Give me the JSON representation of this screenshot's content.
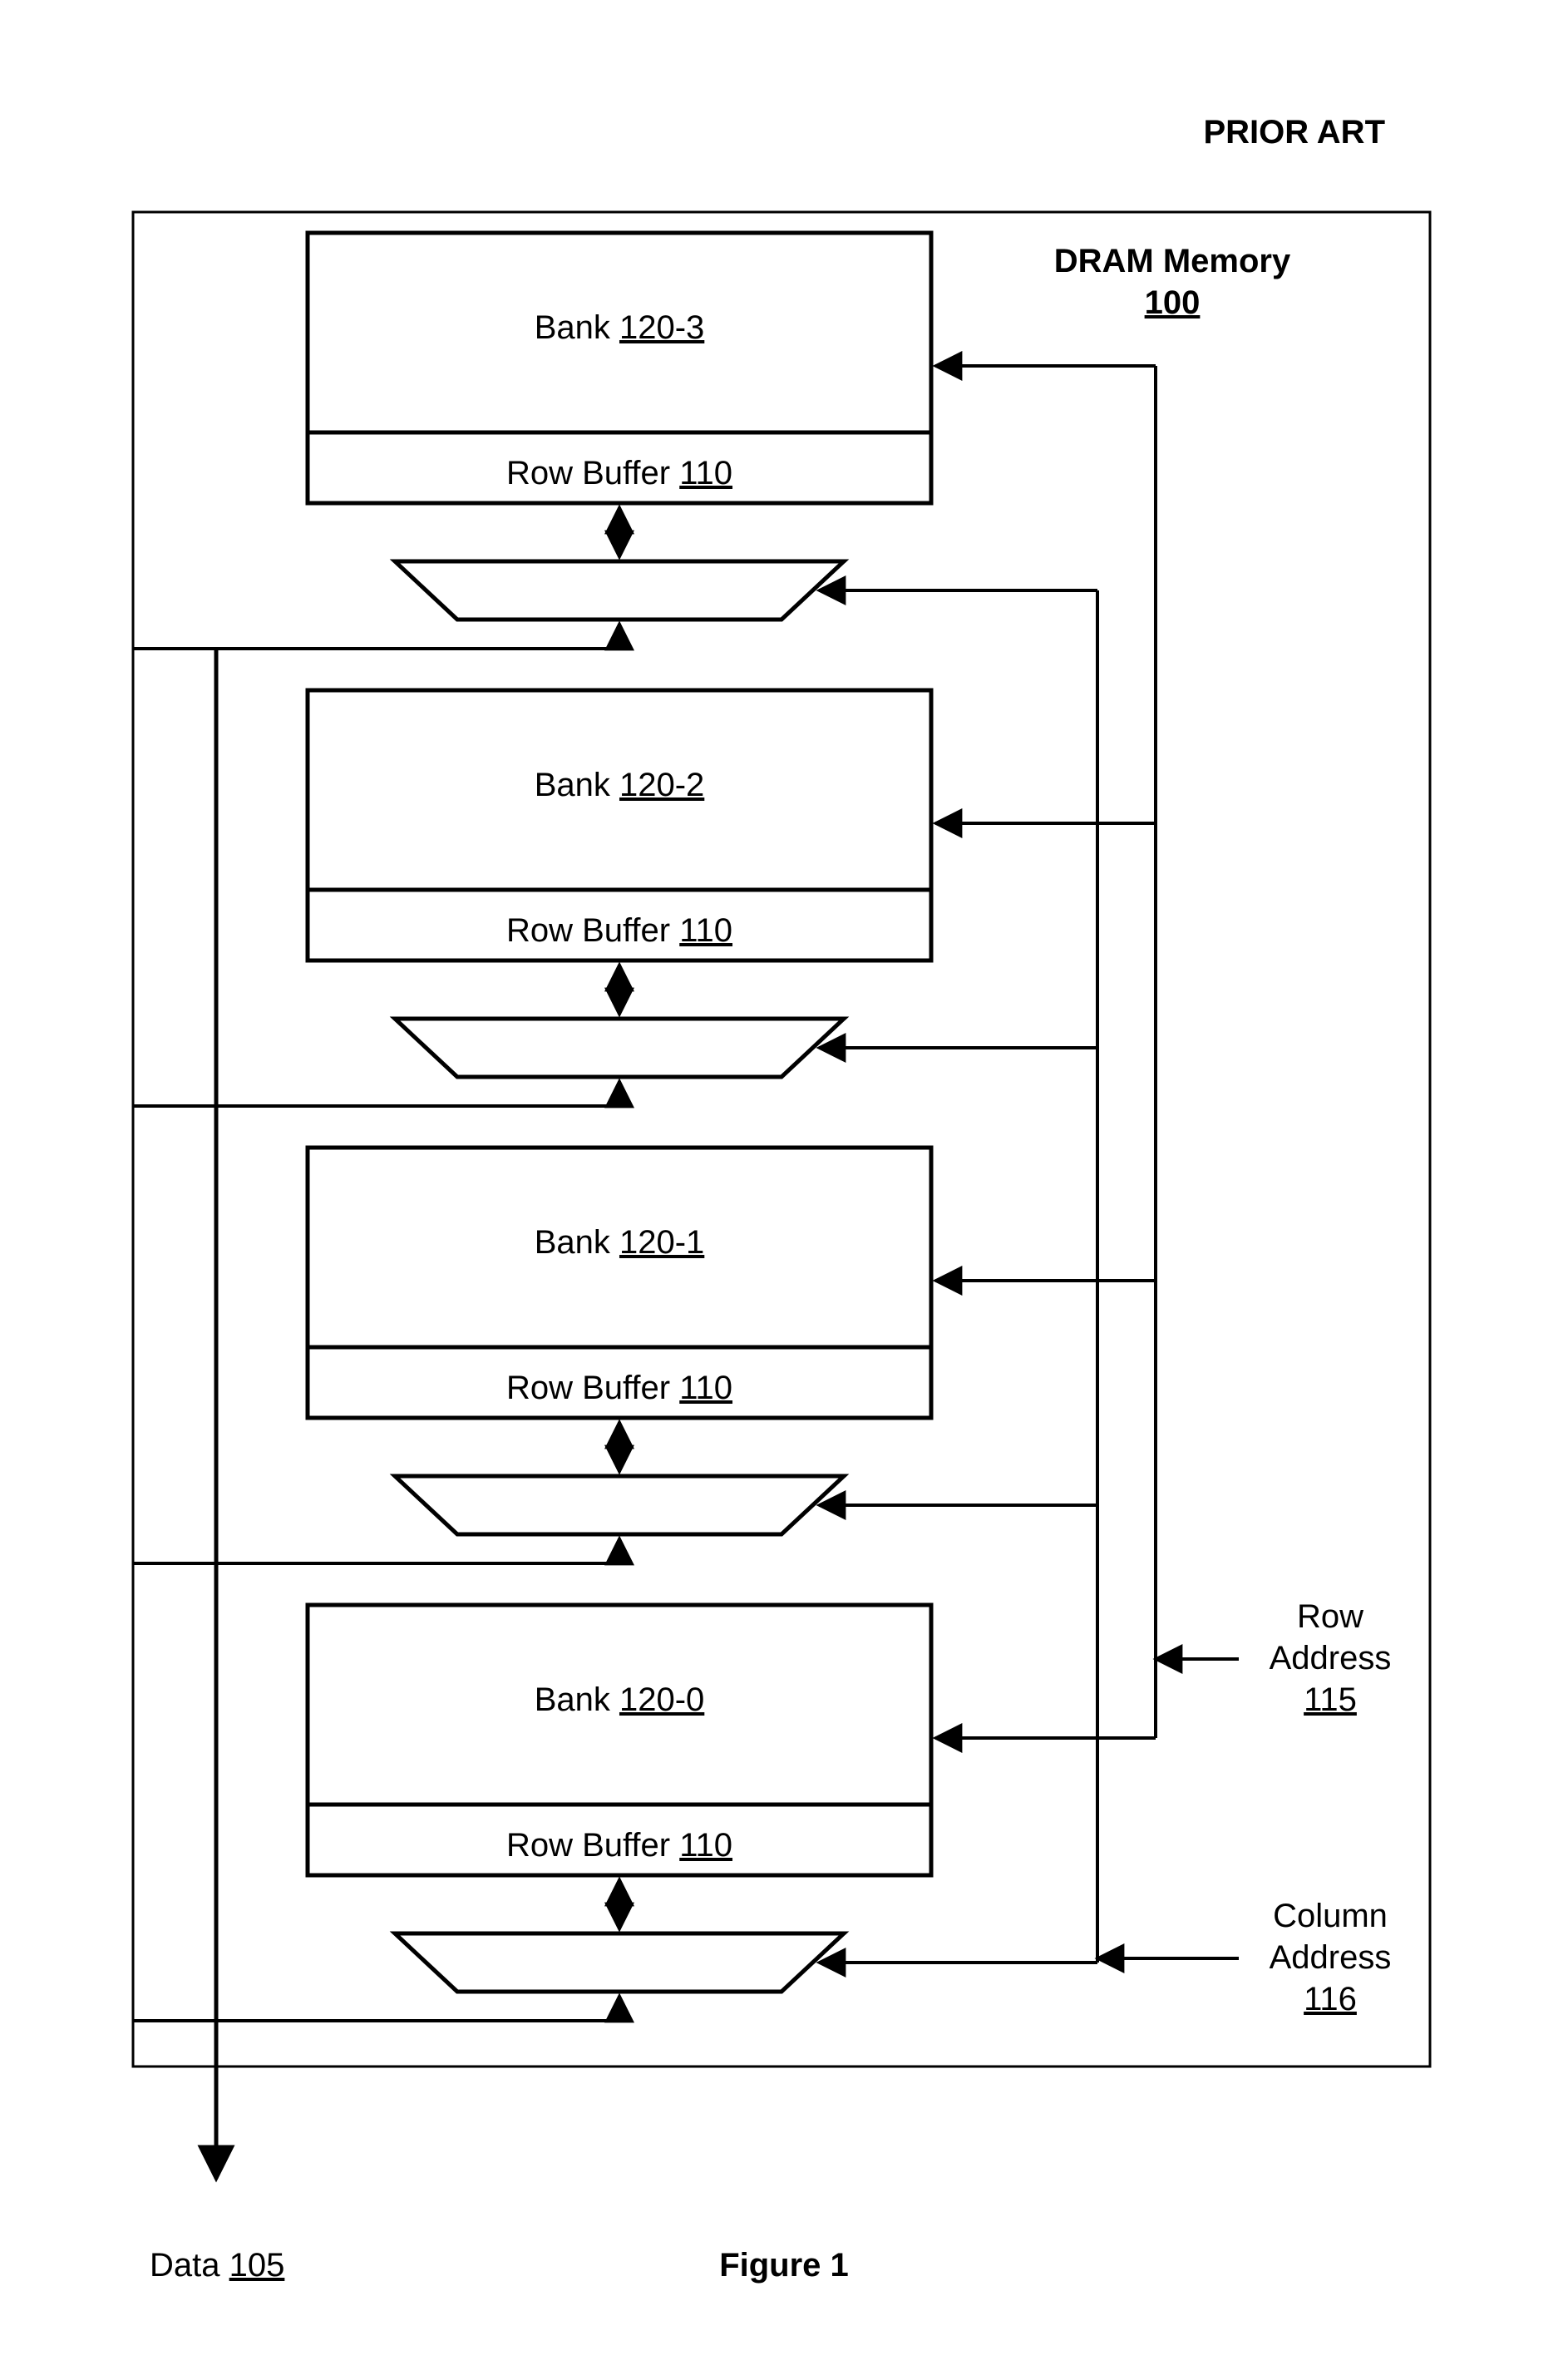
{
  "header": {
    "prior_art": "PRIOR ART"
  },
  "title": {
    "line1": "DRAM Memory",
    "line2": "100"
  },
  "banks": [
    {
      "label_prefix": "Bank ",
      "label_num": "120-3",
      "rb_prefix": "Row Buffer ",
      "rb_num": "110"
    },
    {
      "label_prefix": "Bank ",
      "label_num": "120-2",
      "rb_prefix": "Row Buffer ",
      "rb_num": "110"
    },
    {
      "label_prefix": "Bank ",
      "label_num": "120-1",
      "rb_prefix": "Row Buffer ",
      "rb_num": "110"
    },
    {
      "label_prefix": "Bank ",
      "label_num": "120-0",
      "rb_prefix": "Row Buffer ",
      "rb_num": "110"
    }
  ],
  "signals": {
    "row": {
      "line1": "Row",
      "line2": "Address",
      "num": "115"
    },
    "column": {
      "line1": "Column",
      "line2": "Address",
      "num": "116"
    },
    "data_prefix": "Data ",
    "data_num": "105"
  },
  "caption": "Figure 1"
}
